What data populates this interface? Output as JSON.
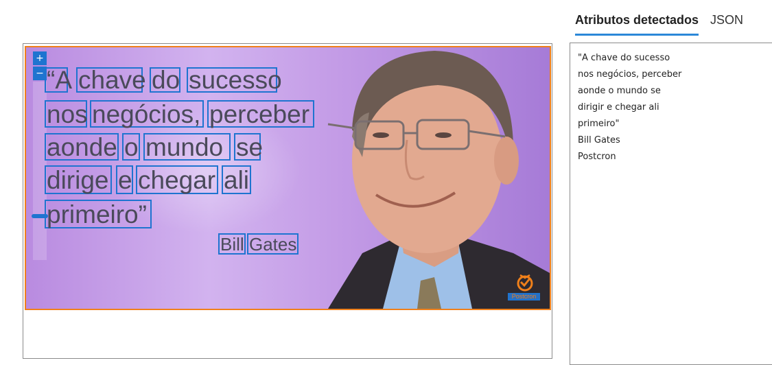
{
  "tabs": {
    "attributes_label": "Atributos detectados",
    "json_label": "JSON"
  },
  "zoom": {
    "zoom_in_label": "+",
    "zoom_out_label": "−"
  },
  "image": {
    "words": [
      {
        "text": "“A"
      },
      {
        "text": "chave"
      },
      {
        "text": "do"
      },
      {
        "text": "sucesso"
      },
      {
        "text": "nos"
      },
      {
        "text": "negócios,"
      },
      {
        "text": "perceber"
      },
      {
        "text": "aonde"
      },
      {
        "text": "o"
      },
      {
        "text": "mundo"
      },
      {
        "text": "se"
      },
      {
        "text": "dirige"
      },
      {
        "text": "e"
      },
      {
        "text": "chegar"
      },
      {
        "text": "ali"
      },
      {
        "text": "primeiro”"
      },
      {
        "text": "Bill"
      },
      {
        "text": "Gates"
      },
      {
        "text": "Postcron"
      }
    ]
  },
  "extracted_text": {
    "lines": [
      "\"A chave do sucesso",
      "nos negócios, perceber",
      "aonde o mundo se",
      "dirigir e chegar ali",
      "primeiro\"",
      "Bill Gates",
      "Postcron"
    ]
  },
  "colors": {
    "accent": "#1e74d0",
    "frame": "#f0801a",
    "tab_underline": "#2b88d8"
  }
}
